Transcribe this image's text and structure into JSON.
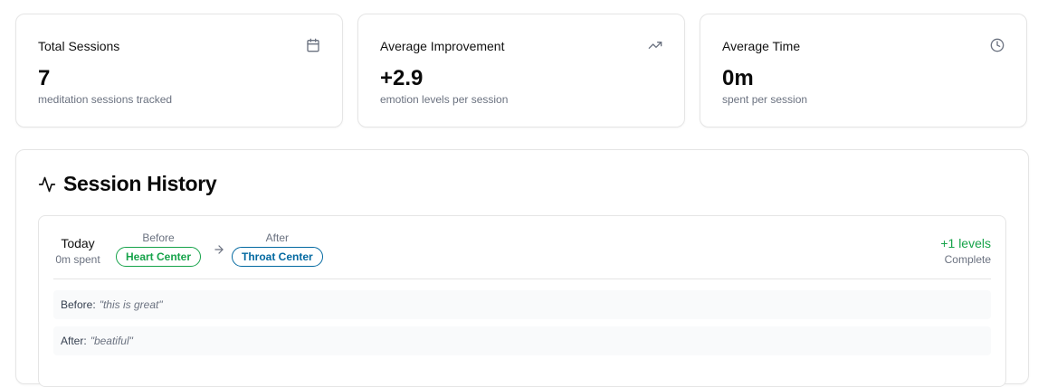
{
  "stats": [
    {
      "title": "Total Sessions",
      "value": "7",
      "subtitle": "meditation sessions tracked",
      "icon": "calendar-icon"
    },
    {
      "title": "Average Improvement",
      "value": "+2.9",
      "subtitle": "emotion levels per session",
      "icon": "trending-up-icon"
    },
    {
      "title": "Average Time",
      "value": "0m",
      "subtitle": "spent per session",
      "icon": "clock-icon"
    }
  ],
  "history": {
    "title": "Session History",
    "icon": "activity-icon",
    "sessions": [
      {
        "date": "Today",
        "spent": "0m spent",
        "before_label": "Before",
        "before_value": "Heart Center",
        "after_label": "After",
        "after_value": "Throat Center",
        "levels": "+1 levels",
        "status": "Complete",
        "note_before_label": "Before:",
        "note_before_text": "\"this is great\"",
        "note_after_label": "After:",
        "note_after_text": "\"beatiful\""
      }
    ]
  },
  "colors": {
    "positive": "#16a34a",
    "after_badge": "#0369a1",
    "muted": "#6b7280",
    "border": "#e5e5e5"
  }
}
